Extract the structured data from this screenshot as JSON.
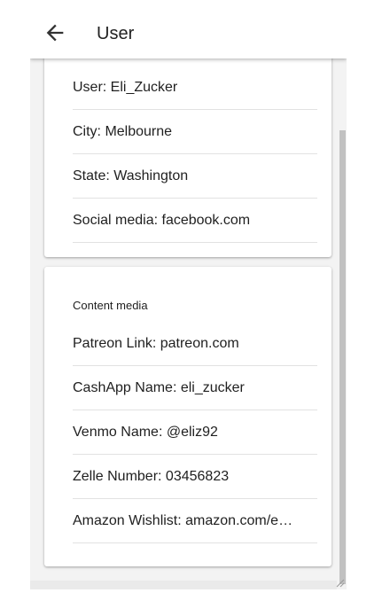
{
  "header": {
    "title": "User",
    "back_icon": "arrow-back-icon"
  },
  "profile_card": {
    "rows": [
      {
        "label": "User: Eli_Zucker"
      },
      {
        "label": "City: Melbourne"
      },
      {
        "label": "State: Washington"
      },
      {
        "label": "Social media: facebook.com"
      }
    ]
  },
  "content_card": {
    "section_title": "Content media",
    "rows": [
      {
        "label": "Patreon Link: patreon.com"
      },
      {
        "label": "CashApp Name: eli_zucker"
      },
      {
        "label": "Venmo Name: @eliz92"
      },
      {
        "label": "Zelle Number: 03456823"
      },
      {
        "label": "Amazon Wishlist: amazon.com/e…"
      }
    ]
  },
  "colors": {
    "background": "#f3f3f3",
    "card": "#ffffff",
    "divider": "#e2e2e2",
    "text": "#1f1f1f",
    "scrollbar_thumb": "#c1c1c1"
  }
}
